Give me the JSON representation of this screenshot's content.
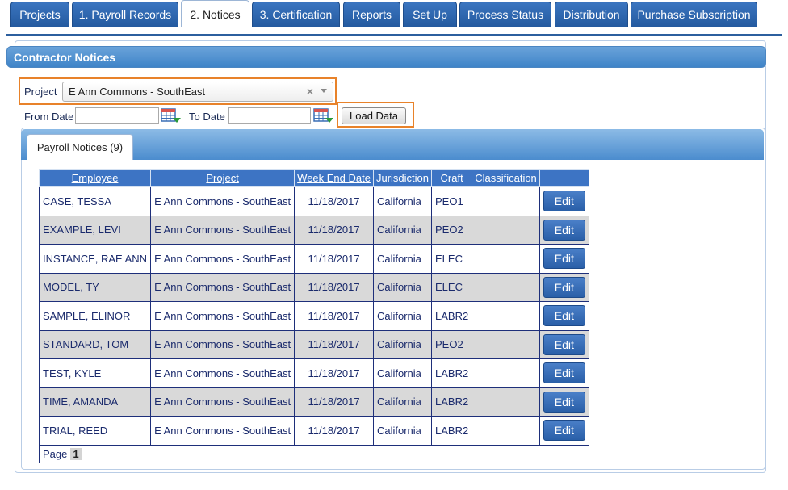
{
  "tabs": [
    {
      "label": "Projects",
      "active": false
    },
    {
      "label": "1. Payroll Records",
      "active": false
    },
    {
      "label": "2. Notices",
      "active": true
    },
    {
      "label": "3. Certification",
      "active": false
    },
    {
      "label": "Reports",
      "active": false
    },
    {
      "label": "Set Up",
      "active": false
    },
    {
      "label": "Process Status",
      "active": false
    },
    {
      "label": "Distribution",
      "active": false
    },
    {
      "label": "Purchase Subscription",
      "active": false
    }
  ],
  "panel": {
    "title": "Contractor Notices"
  },
  "filters": {
    "project_label": "Project",
    "project_value": "E Ann Commons - SouthEast",
    "clear_symbol": "×",
    "from_date_label": "From Date",
    "from_date_value": "",
    "to_date_label": "To Date",
    "to_date_value": "",
    "load_button": "Load Data"
  },
  "inner_tab": {
    "label": "Payroll Notices (9)"
  },
  "table": {
    "headers": [
      "Employee",
      "Project",
      "Week End Date",
      "Jurisdiction",
      "Craft",
      "Classification",
      ""
    ],
    "rows": [
      [
        "CASE, TESSA",
        "E Ann Commons - SouthEast",
        "11/18/2017",
        "California",
        "PEO1",
        "",
        "Edit"
      ],
      [
        "EXAMPLE, LEVI",
        "E Ann Commons - SouthEast",
        "11/18/2017",
        "California",
        "PEO2",
        "",
        "Edit"
      ],
      [
        "INSTANCE, RAE ANN",
        "E Ann Commons - SouthEast",
        "11/18/2017",
        "California",
        "ELEC",
        "",
        "Edit"
      ],
      [
        "MODEL, TY",
        "E Ann Commons - SouthEast",
        "11/18/2017",
        "California",
        "ELEC",
        "",
        "Edit"
      ],
      [
        "SAMPLE, ELINOR",
        "E Ann Commons - SouthEast",
        "11/18/2017",
        "California",
        "LABR2",
        "",
        "Edit"
      ],
      [
        "STANDARD, TOM",
        "E Ann Commons - SouthEast",
        "11/18/2017",
        "California",
        "PEO2",
        "",
        "Edit"
      ],
      [
        "TEST, KYLE",
        "E Ann Commons - SouthEast",
        "11/18/2017",
        "California",
        "LABR2",
        "",
        "Edit"
      ],
      [
        "TIME, AMANDA",
        "E Ann Commons - SouthEast",
        "11/18/2017",
        "California",
        "LABR2",
        "",
        "Edit"
      ],
      [
        "TRIAL, REED",
        "E Ann Commons - SouthEast",
        "11/18/2017",
        "California",
        "LABR2",
        "",
        "Edit"
      ]
    ],
    "pager_label": "Page",
    "current_page": "1"
  },
  "colors": {
    "tab_blue": "#2c65ad",
    "header_blue": "#3d74c4",
    "highlight_orange": "#e8822a",
    "alt_row": "#d9d9d9"
  },
  "icons": [
    "calendar-icon",
    "clear-icon",
    "dropdown-arrow-icon"
  ]
}
